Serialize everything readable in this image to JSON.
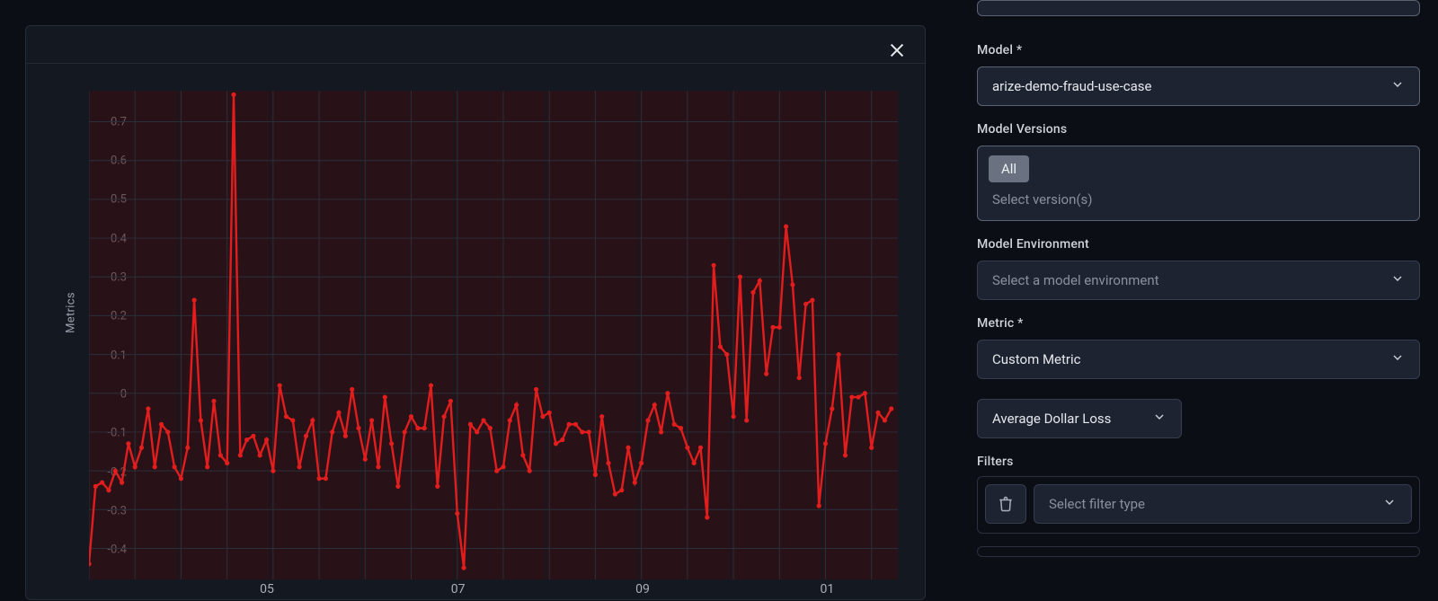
{
  "chart_data": {
    "type": "line",
    "ylabel": "Metrics",
    "y_ticks": [
      -0.4,
      -0.3,
      -0.2,
      -0.1,
      0,
      0.1,
      0.2,
      0.3,
      0.4,
      0.5,
      0.6,
      0.7
    ],
    "ylim": [
      -0.48,
      0.78
    ],
    "x_ticks": [
      "05",
      "07",
      "09",
      "01"
    ],
    "x_tick_positions": [
      27,
      56,
      84,
      112
    ],
    "xlim": [
      0,
      123
    ],
    "x": [
      0,
      1,
      2,
      3,
      4,
      5,
      6,
      7,
      8,
      9,
      10,
      11,
      12,
      13,
      14,
      15,
      16,
      17,
      18,
      19,
      20,
      21,
      22,
      23,
      24,
      25,
      26,
      27,
      28,
      29,
      30,
      31,
      32,
      33,
      34,
      35,
      36,
      37,
      38,
      39,
      40,
      41,
      42,
      43,
      44,
      45,
      46,
      47,
      48,
      49,
      50,
      51,
      52,
      53,
      54,
      55,
      56,
      57,
      58,
      59,
      60,
      61,
      62,
      63,
      64,
      65,
      66,
      67,
      68,
      69,
      70,
      71,
      72,
      73,
      74,
      75,
      76,
      77,
      78,
      79,
      80,
      81,
      82,
      83,
      84,
      85,
      86,
      87,
      88,
      89,
      90,
      91,
      92,
      93,
      94,
      95,
      96,
      97,
      98,
      99,
      100,
      101,
      102,
      103,
      104,
      105,
      106,
      107,
      108,
      109,
      110,
      111,
      112,
      113,
      114,
      115,
      116,
      117,
      118,
      119,
      120,
      121,
      122
    ],
    "values": [
      -0.44,
      -0.24,
      -0.23,
      -0.25,
      -0.2,
      -0.23,
      -0.13,
      -0.19,
      -0.14,
      -0.04,
      -0.19,
      -0.08,
      -0.1,
      -0.19,
      -0.22,
      -0.14,
      0.24,
      -0.07,
      -0.19,
      -0.02,
      -0.16,
      -0.18,
      0.77,
      -0.16,
      -0.12,
      -0.11,
      -0.16,
      -0.12,
      -0.2,
      0.02,
      -0.06,
      -0.07,
      -0.19,
      -0.11,
      -0.07,
      -0.22,
      -0.22,
      -0.1,
      -0.05,
      -0.11,
      0.01,
      -0.09,
      -0.17,
      -0.07,
      -0.19,
      -0.01,
      -0.13,
      -0.24,
      -0.1,
      -0.06,
      -0.09,
      -0.09,
      0.02,
      -0.24,
      -0.06,
      -0.02,
      -0.31,
      -0.45,
      -0.08,
      -0.1,
      -0.07,
      -0.09,
      -0.2,
      -0.19,
      -0.07,
      -0.03,
      -0.16,
      -0.2,
      0.01,
      -0.06,
      -0.05,
      -0.13,
      -0.12,
      -0.08,
      -0.08,
      -0.1,
      -0.1,
      -0.21,
      -0.06,
      -0.18,
      -0.26,
      -0.25,
      -0.14,
      -0.23,
      -0.18,
      -0.07,
      -0.03,
      -0.1,
      0.0,
      -0.08,
      -0.09,
      -0.14,
      -0.18,
      -0.14,
      -0.32,
      0.33,
      0.12,
      0.1,
      -0.06,
      0.3,
      -0.07,
      0.26,
      0.29,
      0.05,
      0.17,
      0.17,
      0.43,
      0.28,
      0.04,
      0.23,
      0.24,
      -0.29,
      -0.13,
      -0.04,
      0.1,
      -0.16,
      -0.01,
      -0.01,
      0.0,
      -0.14,
      -0.05,
      -0.07,
      -0.04
    ],
    "band_gaps": [
      13,
      27,
      41,
      55,
      69,
      83,
      97,
      111
    ],
    "color": "#e11d1d"
  },
  "panel": {
    "model_label": "Model *",
    "model_value": "arize-demo-fraud-use-case",
    "versions_label": "Model Versions",
    "versions_chip": "All",
    "versions_placeholder": "Select version(s)",
    "env_label": "Model Environment",
    "env_placeholder": "Select a model environment",
    "metric_label": "Metric *",
    "metric_value": "Custom Metric",
    "metric_sub_value": "Average Dollar Loss",
    "filters_label": "Filters",
    "filter_placeholder": "Select filter type"
  }
}
